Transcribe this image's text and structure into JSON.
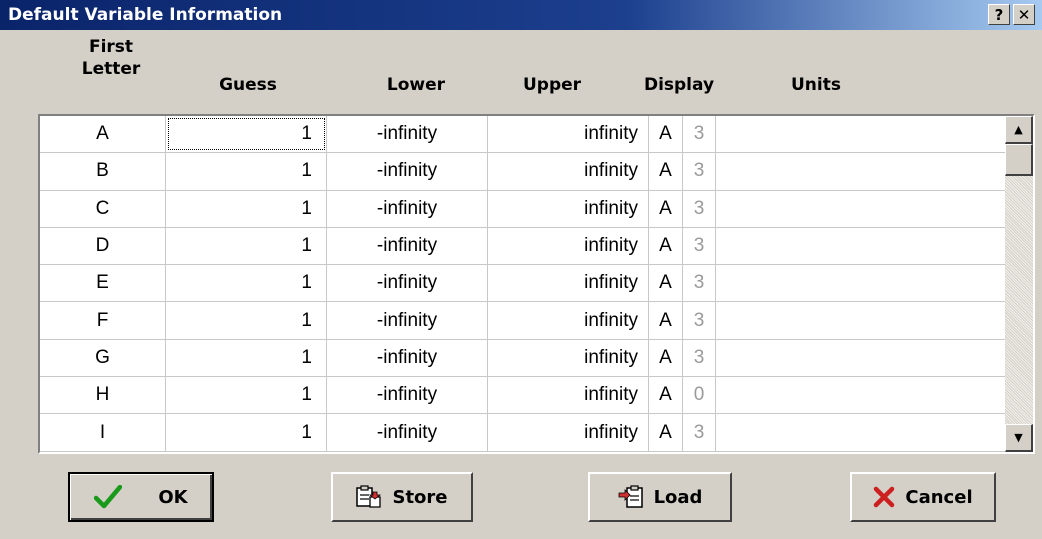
{
  "window": {
    "title": "Default Variable Information",
    "help_label": "?",
    "close_label": "✕"
  },
  "columns": {
    "first_letter_line1": "First",
    "first_letter_line2": "Letter",
    "guess": "Guess",
    "lower": "Lower",
    "upper": "Upper",
    "display": "Display",
    "units": "Units"
  },
  "rows": [
    {
      "letter": "A",
      "guess": "1",
      "lower": "-infinity",
      "upper": "infinity",
      "display_format": "A",
      "display_digits": "3",
      "units": ""
    },
    {
      "letter": "B",
      "guess": "1",
      "lower": "-infinity",
      "upper": "infinity",
      "display_format": "A",
      "display_digits": "3",
      "units": ""
    },
    {
      "letter": "C",
      "guess": "1",
      "lower": "-infinity",
      "upper": "infinity",
      "display_format": "A",
      "display_digits": "3",
      "units": ""
    },
    {
      "letter": "D",
      "guess": "1",
      "lower": "-infinity",
      "upper": "infinity",
      "display_format": "A",
      "display_digits": "3",
      "units": ""
    },
    {
      "letter": "E",
      "guess": "1",
      "lower": "-infinity",
      "upper": "infinity",
      "display_format": "A",
      "display_digits": "3",
      "units": ""
    },
    {
      "letter": "F",
      "guess": "1",
      "lower": "-infinity",
      "upper": "infinity",
      "display_format": "A",
      "display_digits": "3",
      "units": ""
    },
    {
      "letter": "G",
      "guess": "1",
      "lower": "-infinity",
      "upper": "infinity",
      "display_format": "A",
      "display_digits": "3",
      "units": ""
    },
    {
      "letter": "H",
      "guess": "1",
      "lower": "-infinity",
      "upper": "infinity",
      "display_format": "A",
      "display_digits": "0",
      "units": ""
    },
    {
      "letter": "I",
      "guess": "1",
      "lower": "-infinity",
      "upper": "infinity",
      "display_format": "A",
      "display_digits": "3",
      "units": ""
    }
  ],
  "buttons": {
    "ok": "OK",
    "store": "Store",
    "load": "Load",
    "cancel": "Cancel"
  },
  "icons": {
    "ok": "green-checkmark-icon",
    "store": "store-clipboard-icon",
    "load": "load-clipboard-icon",
    "cancel": "red-x-icon"
  },
  "colors": {
    "titlebar_start": "#0a246a",
    "titlebar_end": "#a6caf0",
    "dialog_bg": "#d4d0c8",
    "ok_check": "#1a9a1a",
    "cancel_x": "#cc1f1f",
    "display_digits_text": "#9a9a9a"
  }
}
